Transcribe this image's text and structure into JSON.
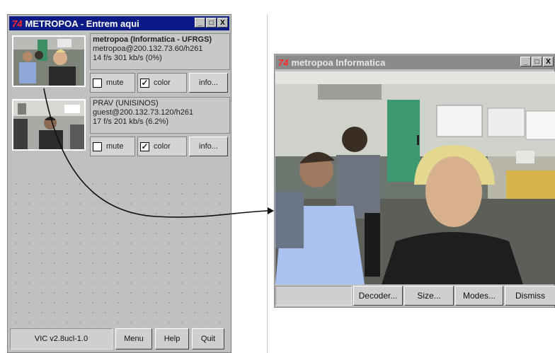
{
  "vic_window": {
    "title": "METROPOA - Entrem aqui",
    "logo_text": "74",
    "window_buttons": [
      "_",
      "□",
      "X"
    ],
    "sources": [
      {
        "line1": "metropoa (Informatica - UFRGS)",
        "line2": "metropoa@200.132.73.60/h261",
        "line3": "14 f/s   301 kb/s   (0%)",
        "mute_label": "mute",
        "mute_checked": "",
        "color_label": "color",
        "color_checked": "✓",
        "info_label": "info..."
      },
      {
        "line1": "PRAV (UNISINOS)",
        "line2": "guest@200.132.73.120/h261",
        "line3": "17 f/s   201 kb/s   (6.2%)",
        "mute_label": "mute",
        "mute_checked": "",
        "color_label": "color",
        "color_checked": "✓",
        "info_label": "info..."
      }
    ],
    "version": "VIC v2.8ucl-1.0",
    "menu_label": "Menu",
    "help_label": "Help",
    "quit_label": "Quit"
  },
  "video_window": {
    "logo_text": "74",
    "title": "metropoa Informatica",
    "window_buttons": [
      "_",
      "□",
      "X"
    ],
    "buttons": {
      "decoder": "Decoder...",
      "size": "Size...",
      "modes": "Modes...",
      "dismiss": "Dismiss"
    }
  },
  "colors": {
    "active_title": "#0a1a86",
    "inactive_title": "#8a8a8a",
    "window_bg": "#c0c0c0",
    "logo_red": "#ff2a2a"
  }
}
